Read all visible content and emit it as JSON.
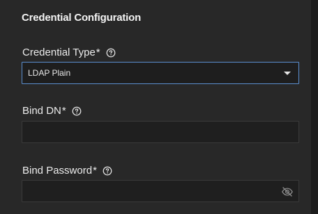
{
  "section": {
    "title": "Credential Configuration"
  },
  "credential_type": {
    "label": "Credential Type",
    "required_mark": "*",
    "selected_value": "LDAP Plain",
    "help_icon": "help-circle-icon",
    "dropdown_icon": "caret-down-icon"
  },
  "bind_dn": {
    "label": "Bind DN",
    "required_mark": "*",
    "value": "",
    "help_icon": "help-circle-icon"
  },
  "bind_password": {
    "label": "Bind Password",
    "required_mark": "*",
    "value": "",
    "help_icon": "help-circle-icon",
    "visibility_icon": "eye-off-icon"
  },
  "colors": {
    "panel_background": "#282828",
    "input_background": "#1f1f1f",
    "focus_border": "#5b8fd0",
    "text": "#f2f2f2"
  }
}
